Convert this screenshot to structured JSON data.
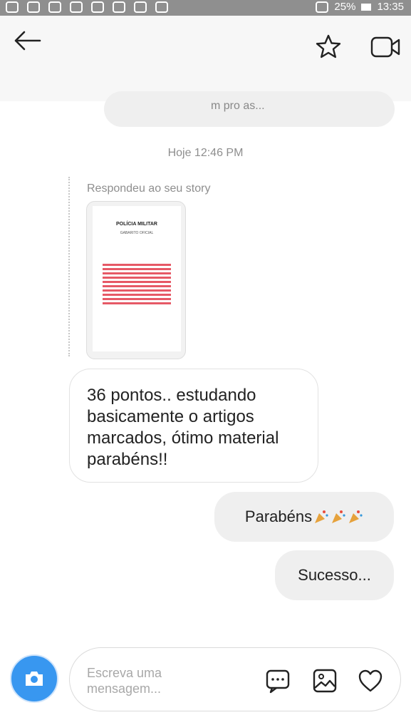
{
  "status_bar": {
    "battery": "25%",
    "time": "13:35",
    "icons": [
      "message-icon",
      "facebook-icon",
      "instagram-icon",
      "instagram-icon",
      "instagram-icon",
      "mute-icon",
      "alarm-icon",
      "wifi-icon",
      "sim-icon",
      "signal-icon",
      "signal-icon",
      "battery-icon"
    ]
  },
  "header": {
    "back_icon": "back-arrow-icon",
    "favorite_icon": "star-icon",
    "video_icon": "video-call-icon",
    "preview_text": "m pro as..."
  },
  "conversation": {
    "timestamp": "Hoje 12:46 PM",
    "story_reply": {
      "label": "Respondeu ao seu story",
      "thumb_title": "POLÍCIA MILITAR",
      "thumb_subtitle": "GABARITO OFICIAL"
    },
    "messages": [
      {
        "from": "them",
        "text": "36 pontos.. estudando basicamente o artigos marcados, ótimo material parabéns!!"
      },
      {
        "from": "me",
        "text": "Parabéns",
        "emoji": "party-popper-icon ×3"
      },
      {
        "from": "me",
        "text": "Sucesso..."
      }
    ]
  },
  "composer": {
    "placeholder": "Escreva uma mensagem...",
    "camera_icon": "camera-icon",
    "sticker_icon": "sticker-icon",
    "gallery_icon": "gallery-icon",
    "like_icon": "heart-icon"
  },
  "colors": {
    "accent": "#3897f0",
    "bubble_out": "#efefef",
    "bubble_in_border": "#e2e2e2",
    "muted_text": "#8e8e8e"
  }
}
